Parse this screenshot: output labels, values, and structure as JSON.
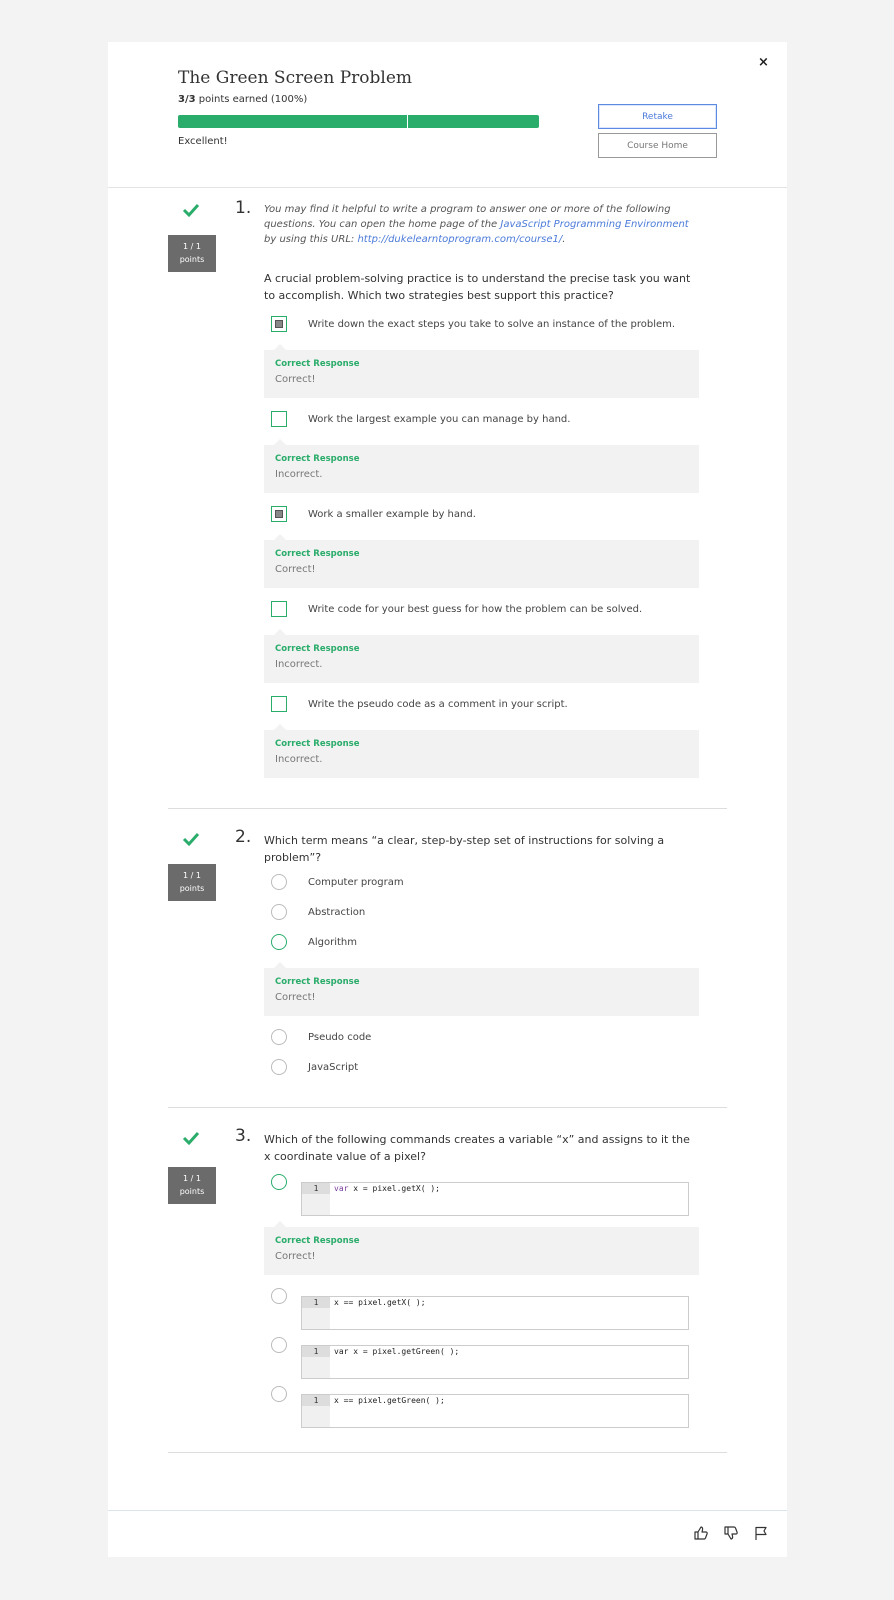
{
  "header": {
    "title": "The Green Screen Problem",
    "score_bold": "3/3",
    "score_rest": " points earned (100%)",
    "progress_fraction": 1.0,
    "feedback": "Excellent!",
    "retake_label": "Retake",
    "course_home_label": "Course Home",
    "close_label": "×"
  },
  "colors": {
    "accent_green": "#2aac6a",
    "link_blue": "#4b7bd9",
    "points_badge": "#6b6b6b"
  },
  "questions": [
    {
      "number": "1.",
      "points_line1": "1 / 1",
      "points_line2": "points",
      "intro_part1": "You may find it helpful to write a program to answer one or more of the following questions. You can open the home page of the ",
      "intro_link1": "JavaScript Programming Environment",
      "intro_part2": " by using this URL: ",
      "intro_link2": "http://dukelearntoprogram.com/course1/",
      "intro_part3": ".",
      "text": "A crucial problem-solving practice is to understand the precise task you want to accomplish. Which two strategies best support this practice?",
      "options": [
        {
          "label": "Write down the exact steps you take to solve an instance of the problem.",
          "checked": true,
          "response_header": "Correct Response",
          "response_text": "Correct!"
        },
        {
          "label": "Work the largest example you can manage by hand.",
          "checked": false,
          "response_header": "Correct Response",
          "response_text": "Incorrect."
        },
        {
          "label": "Work a smaller example by hand.",
          "checked": true,
          "response_header": "Correct Response",
          "response_text": "Correct!"
        },
        {
          "label": "Write code for your best guess for how the problem can be solved.",
          "checked": false,
          "response_header": "Correct Response",
          "response_text": "Incorrect."
        },
        {
          "label": "Write the pseudo code as a comment in your script.",
          "checked": false,
          "response_header": "Correct Response",
          "response_text": "Incorrect."
        }
      ]
    },
    {
      "number": "2.",
      "points_line1": "1 / 1",
      "points_line2": "points",
      "text": "Which term means “a clear, step-by-step set of instructions for solving a problem”?",
      "options": [
        {
          "label": "Computer program",
          "selected": false
        },
        {
          "label": "Abstraction",
          "selected": false
        },
        {
          "label": "Algorithm",
          "selected": true,
          "response_header": "Correct Response",
          "response_text": "Correct!"
        },
        {
          "label": "Pseudo code",
          "selected": false
        },
        {
          "label": "JavaScript",
          "selected": false
        }
      ]
    },
    {
      "number": "3.",
      "points_line1": "1 / 1",
      "points_line2": "points",
      "text": "Which of the following commands creates a variable “x” and assigns to it the x coordinate value of a pixel?",
      "options": [
        {
          "line_number": "1",
          "code_keyword": "var",
          "code_rest": " x = pixel.getX( );",
          "selected": true,
          "response_header": "Correct Response",
          "response_text": "Correct!"
        },
        {
          "line_number": "1",
          "code_keyword": "",
          "code_rest": "x == pixel.getX( );",
          "selected": false
        },
        {
          "line_number": "1",
          "code_keyword": "",
          "code_rest": "var x = pixel.getGreen( );",
          "selected": false
        },
        {
          "line_number": "1",
          "code_keyword": "",
          "code_rest": "x == pixel.getGreen( );",
          "selected": false
        }
      ]
    }
  ],
  "footer": {
    "icons": [
      "thumbs-up-icon",
      "thumbs-down-icon",
      "flag-icon"
    ]
  }
}
